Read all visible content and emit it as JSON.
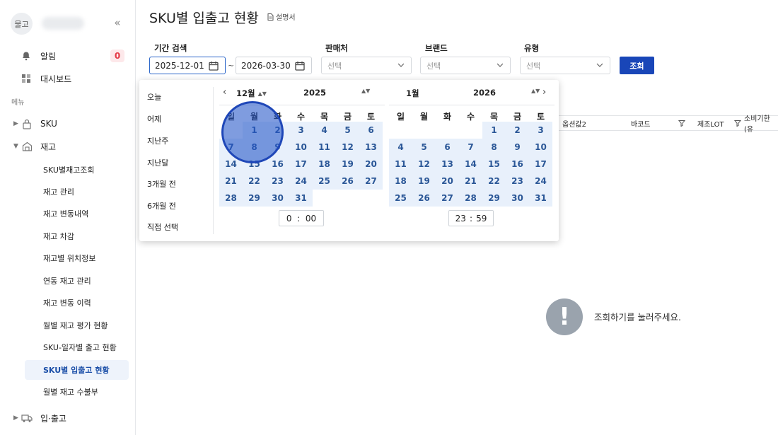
{
  "sidebar": {
    "avatar": "물고",
    "collapse": "«",
    "alerts": {
      "label": "알림",
      "count": "0"
    },
    "dashboard": "대시보드",
    "menu_section": "메뉴",
    "sku": "SKU",
    "inventory": "재고",
    "sub_items": [
      "SKU별재고조회",
      "재고 관리",
      "재고 변동내역",
      "재고 차감",
      "재고별 위치정보",
      "연동 재고 관리",
      "재고 변동 이력",
      "월별 재고 평가 현황",
      "SKU-일자별 출고 현황",
      "SKU별 입출고 현황",
      "월별 재고 수불부"
    ],
    "inout": "입·출고"
  },
  "page": {
    "title": "SKU별 입출고 현황",
    "manual": "설명서"
  },
  "filters": {
    "period_label": "기간 검색",
    "start_date": "2025-12-01",
    "end_date": "2026-03-30",
    "tilde": "~",
    "seller_label": "판매처",
    "brand_label": "브랜드",
    "type_label": "유형",
    "select_placeholder": "선택",
    "search_button": "조회"
  },
  "table_headers": [
    "옵션값2",
    "바코드",
    "제조LOT",
    "소비기한(유"
  ],
  "empty_message": "조회하기를 눌러주세요.",
  "picker": {
    "presets": [
      "오늘",
      "어제",
      "지난주",
      "지난달",
      "3개월 전",
      "6개월 전",
      "직접 선택"
    ],
    "weekdays": [
      "일",
      "월",
      "화",
      "수",
      "목",
      "금",
      "토"
    ],
    "left": {
      "month": "12월",
      "year": "2025",
      "first_weekday": 1,
      "days_in_month": 31,
      "time_hour": "0",
      "time_min": "00"
    },
    "right": {
      "month": "1월",
      "year": "2026",
      "first_weekday": 4,
      "days_in_month": 31,
      "time_hour": "23",
      "time_min": "59"
    },
    "time_sep": ":"
  },
  "colors": {
    "primary": "#1946b8",
    "day_text": "#2b5797",
    "day_bg": "#e8f0fb",
    "badge": "#e53946"
  }
}
